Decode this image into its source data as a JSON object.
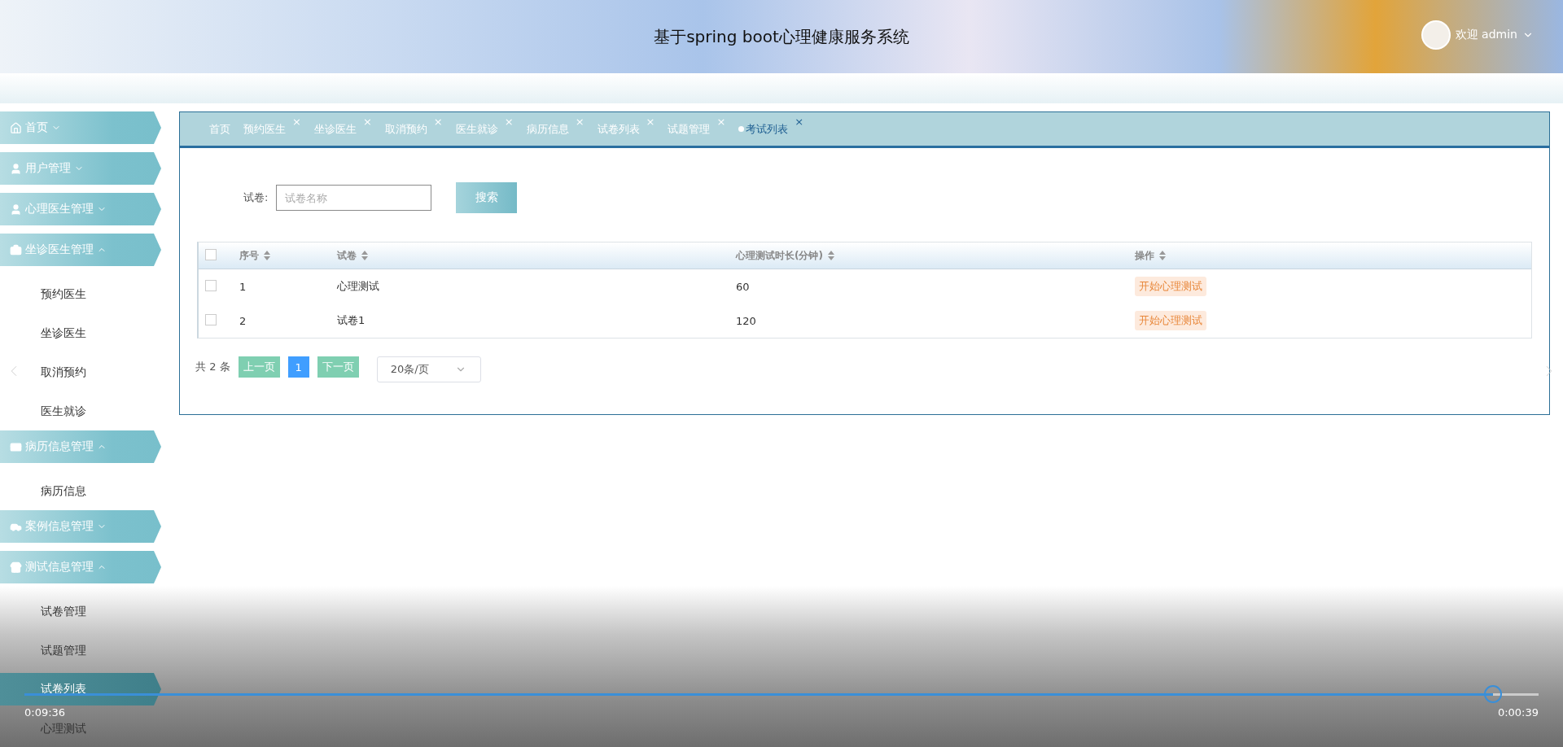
{
  "header": {
    "title": "基于spring boot心理健康服务系统",
    "user": "欢迎 admin"
  },
  "sidebar": {
    "groups": [
      {
        "label": "首页",
        "expanded": false
      },
      {
        "label": "用户管理",
        "expanded": false
      },
      {
        "label": "心理医生管理",
        "expanded": false
      },
      {
        "label": "坐诊医生管理",
        "expanded": true,
        "children": [
          {
            "label": "预约医生",
            "selected": false
          },
          {
            "label": "坐诊医生",
            "selected": false
          },
          {
            "label": "取消预约",
            "selected": false
          },
          {
            "label": "医生就诊",
            "selected": false
          }
        ]
      },
      {
        "label": "病历信息管理",
        "expanded": true,
        "children": [
          {
            "label": "病历信息",
            "selected": false
          }
        ]
      },
      {
        "label": "案例信息管理",
        "expanded": false
      },
      {
        "label": "测试信息管理",
        "expanded": true,
        "children": [
          {
            "label": "试卷管理",
            "selected": false
          },
          {
            "label": "试题管理",
            "selected": false
          },
          {
            "label": "试卷列表",
            "selected": true
          },
          {
            "label": "心理测试",
            "selected": false
          }
        ]
      }
    ]
  },
  "tabs": [
    {
      "label": "首页",
      "selected": false,
      "closable": false
    },
    {
      "label": "预约医生",
      "selected": false,
      "closable": true
    },
    {
      "label": "坐诊医生",
      "selected": false,
      "closable": true
    },
    {
      "label": "取消预约",
      "selected": false,
      "closable": true
    },
    {
      "label": "医生就诊",
      "selected": false,
      "closable": true
    },
    {
      "label": "病历信息",
      "selected": false,
      "closable": true
    },
    {
      "label": "试卷列表",
      "selected": false,
      "closable": true
    },
    {
      "label": "试题管理",
      "selected": false,
      "closable": true
    },
    {
      "label": "考试列表",
      "selected": true,
      "closable": true
    }
  ],
  "close_mark": "×",
  "search": {
    "label": "试卷:",
    "placeholder": "试卷名称",
    "button": "搜索"
  },
  "table": {
    "all_checked": false,
    "columns": [
      "序号",
      "试卷",
      "心理测试时长(分钟)",
      "操作"
    ],
    "rows": [
      {
        "checked": false,
        "cells": [
          "1",
          "心理测试",
          "60"
        ],
        "action": "开始心理测试"
      },
      {
        "checked": false,
        "cells": [
          "2",
          "试卷1",
          "120"
        ],
        "action": "开始心理测试"
      }
    ]
  },
  "pagination": {
    "total": "共 2 条",
    "prev": "上一页",
    "page": "1",
    "next": "下一页",
    "page_size": "20条/页"
  },
  "player": {
    "elapsed": "0:09:36",
    "remaining": "0:00:39",
    "level": 0.97
  }
}
